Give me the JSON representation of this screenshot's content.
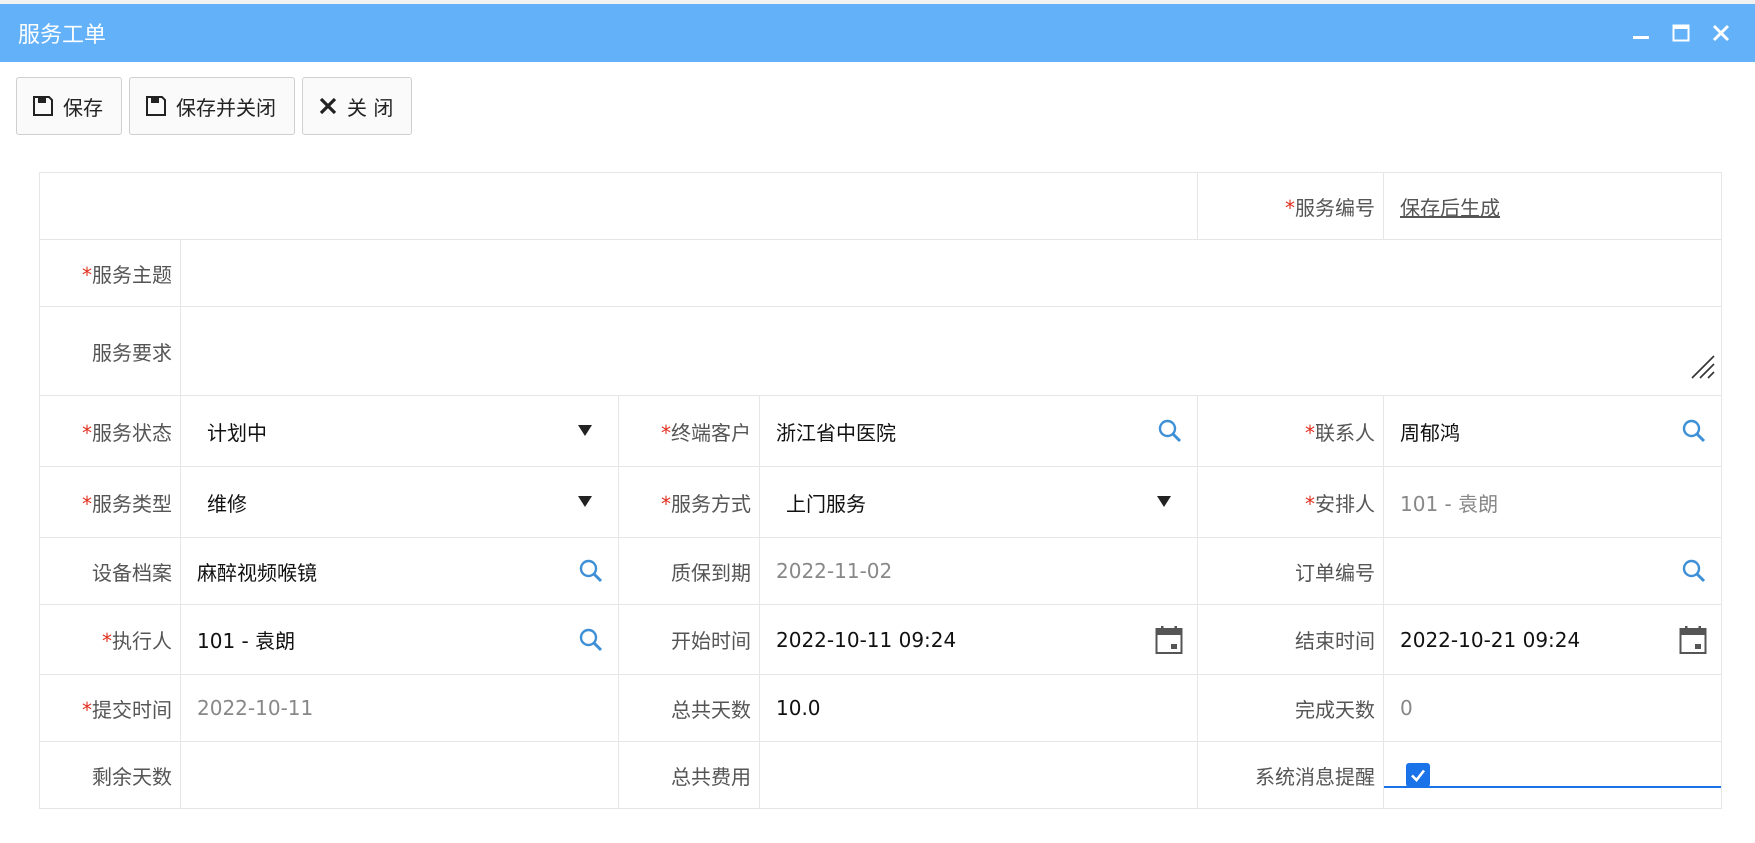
{
  "window": {
    "title": "服务工单"
  },
  "toolbar": {
    "save_label": "保存",
    "save_close_label": "保存并关闭",
    "close_label": "关 闭"
  },
  "form": {
    "service_no": {
      "label": "服务编号",
      "value": "保存后生成"
    },
    "subject": {
      "label": "服务主题",
      "value": ""
    },
    "requirement": {
      "label": "服务要求",
      "value": ""
    },
    "status": {
      "label": "服务状态",
      "value": "计划中"
    },
    "customer": {
      "label": "终端客户",
      "value": "浙江省中医院"
    },
    "contact": {
      "label": "联系人",
      "value": "周郁鸿"
    },
    "service_type": {
      "label": "服务类型",
      "value": "维修"
    },
    "service_mode": {
      "label": "服务方式",
      "value": "上门服务"
    },
    "arranger": {
      "label": "安排人",
      "value": "101 - 袁朗"
    },
    "equipment": {
      "label": "设备档案",
      "value": "麻醉视频喉镜"
    },
    "warranty_end": {
      "label": "质保到期",
      "value": "2022-11-02"
    },
    "order_no": {
      "label": "订单编号",
      "value": ""
    },
    "executor": {
      "label": "执行人",
      "value": "101 - 袁朗"
    },
    "start_time": {
      "label": "开始时间",
      "value": "2022-10-11 09:24"
    },
    "end_time": {
      "label": "结束时间",
      "value": "2022-10-21 09:24"
    },
    "submit_time": {
      "label": "提交时间",
      "value": "2022-10-11"
    },
    "total_days": {
      "label": "总共天数",
      "value": "10.0"
    },
    "done_days": {
      "label": "完成天数",
      "value": "0"
    },
    "remaining_days": {
      "label": "剩余天数",
      "value": ""
    },
    "total_cost": {
      "label": "总共费用",
      "value": ""
    },
    "sys_notify": {
      "label": "系统消息提醒",
      "checked": true
    }
  },
  "required_mark": "*",
  "colors": {
    "titlebar": "#62b1f9",
    "required": "#e0301e",
    "accent": "#1a73e8"
  }
}
